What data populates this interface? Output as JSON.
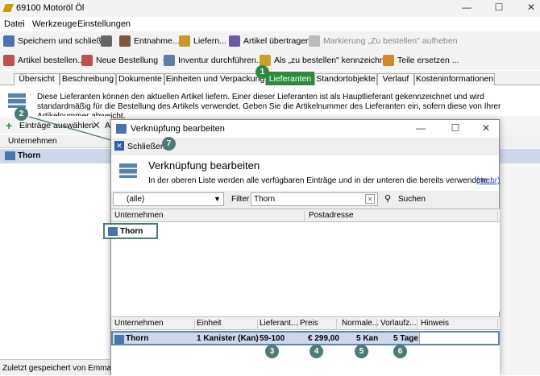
{
  "app": {
    "title": "69100 Motoröl Öl",
    "min": "—",
    "max": "☐",
    "close": "✕"
  },
  "menu": [
    "Datei",
    "Werkzeuge",
    "Einstellungen"
  ],
  "toolbar1": [
    "Speichern und schließen",
    "Entnahme...",
    "Liefern...",
    "Artikel übertragen",
    "Markierung „Zu bestellen\" aufheben"
  ],
  "toolbar2": [
    "Artikel bestellen...",
    "Neue Bestellung",
    "Inventur durchführen...",
    "Als „zu bestellen\" kennzeichnen",
    "Teile ersetzen ..."
  ],
  "tabs": [
    "Übersicht",
    "Beschreibung",
    "Dokumente",
    "Einheiten und Verpackung",
    "Lieferanten",
    "Standortobjekte",
    "Verlauf",
    "Kosteninformationen"
  ],
  "info_text": "Diese Lieferanten können den aktuellen Artikel liefern. Einer dieser Lieferanten ist als Hauptlieferant gekennzeichnet und wird standardmäßig für die Bestellung des Artikels verwendet. Geben Sie die Artikelnummer des Lieferanten ein, sofern diese von Ihrer Artikelnummer abweicht.",
  "left": {
    "add": "Einträge auswählen",
    "remove": "A",
    "col_company": "Unternehmen",
    "row": "Thorn"
  },
  "status": "Zuletzt gespeichert von Emma Lem",
  "dialog": {
    "title": "Verknüpfung bearbeiten",
    "close_btn": "Schließen",
    "heading": "Verknüpfung bearbeiten",
    "subtext": "In der oberen Liste werden alle verfügbaren Einträge und in der unteren die bereits verwendete...",
    "more": "(mehr)",
    "dropdown": "(alle)",
    "filter_label": "Filter",
    "filter_value": "Thorn",
    "search_btn": "Suchen",
    "grid1_cols": [
      "Unternehmen",
      "Postadresse"
    ],
    "grid1_row": "Thorn",
    "grid2_cols": [
      "Unternehmen",
      "Einheit",
      "Lieferant...",
      "Preis",
      "Normale...",
      "Vorlaufz...",
      "Hinweis"
    ],
    "grid2_row": {
      "company": "Thorn",
      "unit": "1 Kanister (Kan)",
      "supplier": "59-100",
      "price": "€ 299,00",
      "normal": "5 Kan",
      "lead": "5 Tage"
    }
  },
  "badges": [
    "1",
    "2",
    "3",
    "4",
    "5",
    "6",
    "7"
  ],
  "colors": {
    "accent_green": "#2e8b3e",
    "badge": "#4b7b78",
    "selection": "#cfd8ea"
  }
}
